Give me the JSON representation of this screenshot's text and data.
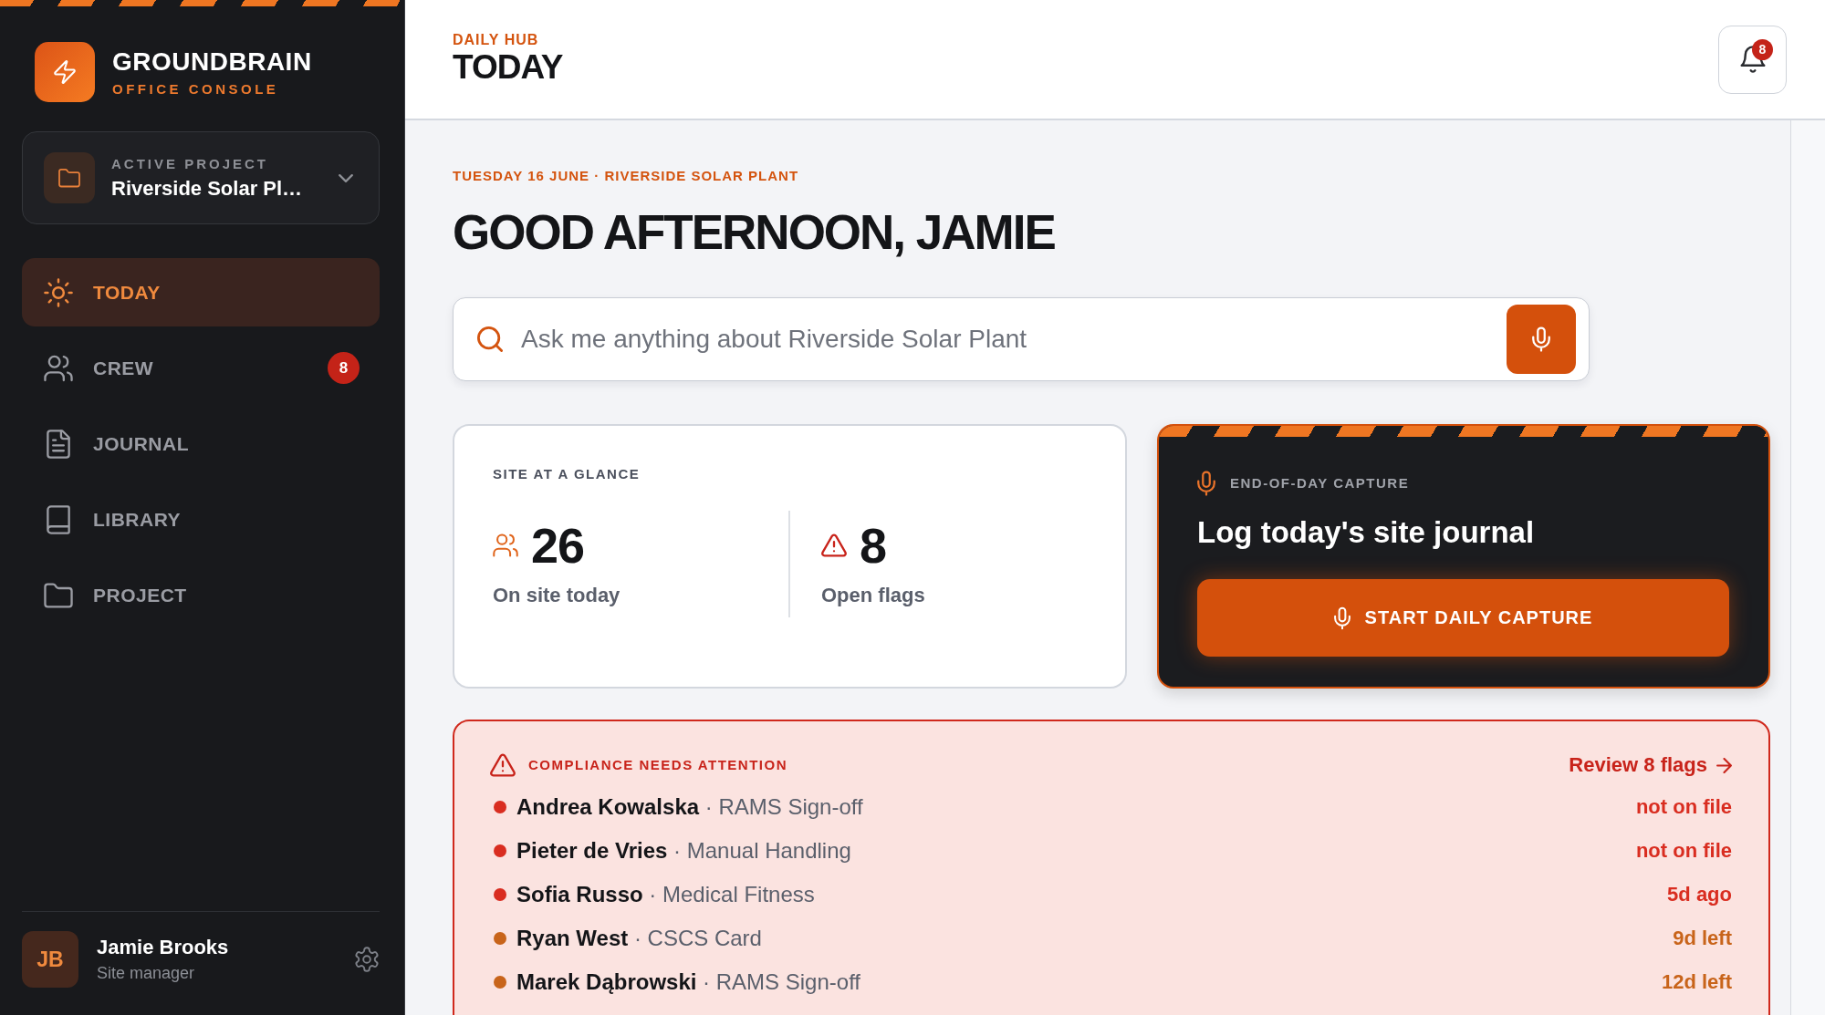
{
  "sidebar": {
    "brand": {
      "title": "GROUNDBRAIN",
      "subtitle": "OFFICE CONSOLE"
    },
    "project_picker": {
      "label": "ACTIVE PROJECT",
      "value": "Riverside Solar Pl…"
    },
    "nav": [
      {
        "label": "TODAY",
        "selected": true
      },
      {
        "label": "CREW",
        "selected": false,
        "badge": "8"
      },
      {
        "label": "JOURNAL",
        "selected": false
      },
      {
        "label": "LIBRARY",
        "selected": false
      },
      {
        "label": "PROJECT",
        "selected": false
      }
    ],
    "user": {
      "initials": "JB",
      "name": "Jamie Brooks",
      "role": "Site manager"
    }
  },
  "header": {
    "eyebrow": "DAILY HUB",
    "title": "TODAY",
    "notification_count": "8"
  },
  "greeting": {
    "date_line": "TUESDAY 16 JUNE · RIVERSIDE SOLAR PLANT",
    "title": "GOOD AFTERNOON, JAMIE"
  },
  "search": {
    "placeholder": "Ask me anything about Riverside Solar Plant"
  },
  "site_at_a_glance": {
    "title": "SITE AT A GLANCE",
    "stats": [
      {
        "kind": "crew",
        "value": "26",
        "label": "On site today"
      },
      {
        "kind": "flags",
        "value": "8",
        "label": "Open flags"
      }
    ]
  },
  "capture": {
    "eyebrow": "END-OF-DAY CAPTURE",
    "title": "Log today's site journal",
    "button": "START DAILY CAPTURE"
  },
  "compliance": {
    "title": "COMPLIANCE NEEDS ATTENTION",
    "link": "Review 8 flags",
    "rows": [
      {
        "text": "**Andrea Kowalska** · RAMS Sign-off",
        "status": "not on file",
        "color": "#d92d20"
      },
      {
        "text": "**Pieter de Vries** · Manual Handling",
        "status": "not on file",
        "color": "#d92d20"
      },
      {
        "text": "**Sofia Russo** · Medical Fitness",
        "status": "5d ago",
        "color": "#d92d20"
      },
      {
        "text": "**Ryan West** · CSCS Card",
        "status": "9d left",
        "color": "#c8641a"
      },
      {
        "text": "**Marek Dąbrowski** · RAMS Sign-off",
        "status": "12d left",
        "color": "#c8641a"
      }
    ]
  }
}
